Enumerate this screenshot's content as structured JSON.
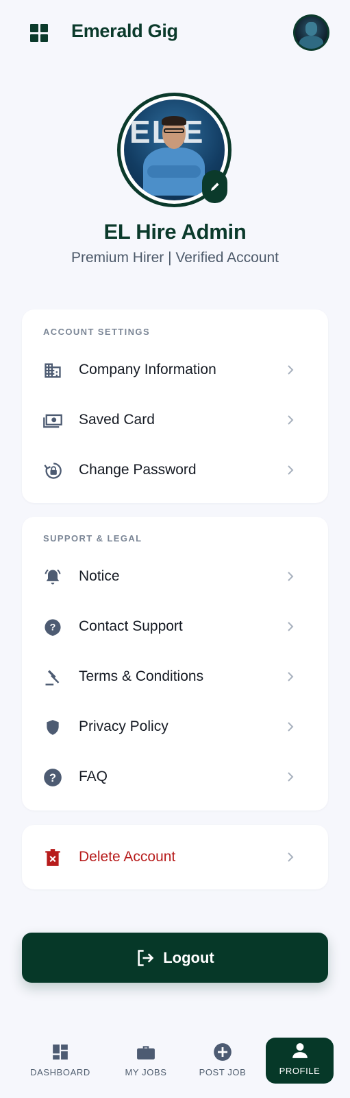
{
  "header": {
    "brand": "Emerald Gig"
  },
  "profile": {
    "photo_text": "EL  E",
    "name": "EL Hire Admin",
    "subtitle": "Premium Hirer | Verified Account"
  },
  "account_settings": {
    "title": "ACCOUNT SETTINGS",
    "items": [
      {
        "label": "Company Information",
        "icon": "building-icon"
      },
      {
        "label": "Saved Card",
        "icon": "cash-icon"
      },
      {
        "label": "Change Password",
        "icon": "lock-reset-icon"
      }
    ]
  },
  "support_legal": {
    "title": "SUPPORT & LEGAL",
    "items": [
      {
        "label": "Notice",
        "icon": "bell-icon"
      },
      {
        "label": "Contact Support",
        "icon": "help-chat-icon"
      },
      {
        "label": "Terms & Conditions",
        "icon": "gavel-icon"
      },
      {
        "label": "Privacy Policy",
        "icon": "shield-icon"
      },
      {
        "label": "FAQ",
        "icon": "help-circle-icon"
      }
    ]
  },
  "danger": {
    "label": "Delete Account",
    "icon": "delete-icon"
  },
  "logout": {
    "label": "Logout"
  },
  "nav": {
    "items": [
      {
        "label": "DASHBOARD",
        "icon": "dashboard-icon"
      },
      {
        "label": "MY JOBS",
        "icon": "briefcase-icon"
      },
      {
        "label": "POST JOB",
        "icon": "add-circle-icon"
      },
      {
        "label": "PROFILE",
        "icon": "person-icon",
        "active": true
      }
    ]
  },
  "colors": {
    "brand": "#0b3a2b",
    "background": "#f6f7fc",
    "danger": "#b71c1c",
    "icon": "#4d5b72"
  }
}
